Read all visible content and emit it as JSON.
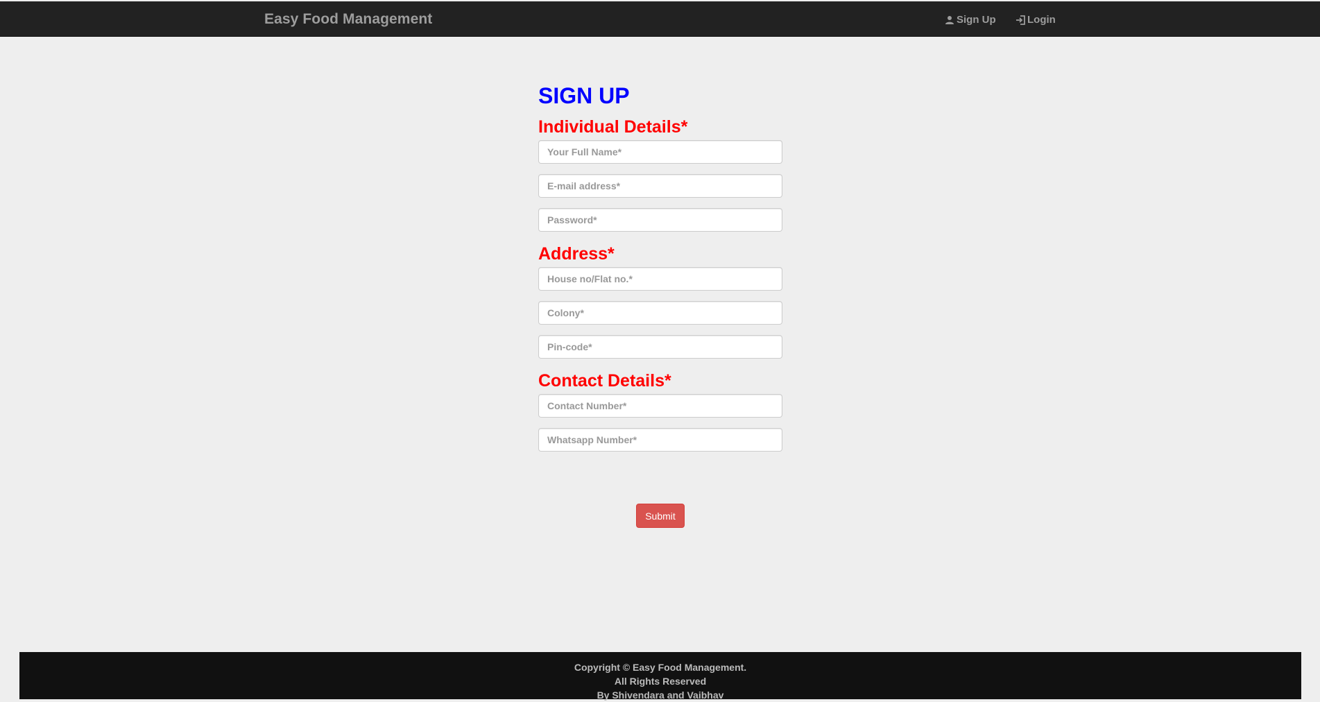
{
  "navbar": {
    "brand": "Easy Food Management",
    "signup_label": "Sign Up",
    "login_label": "Login"
  },
  "form": {
    "title": "SIGN UP",
    "sections": {
      "individual": {
        "title": "Individual Details*",
        "full_name_placeholder": "Your Full Name*",
        "email_placeholder": "E-mail address*",
        "password_placeholder": "Password*"
      },
      "address": {
        "title": "Address*",
        "house_placeholder": "House no/Flat no.*",
        "colony_placeholder": "Colony*",
        "pincode_placeholder": "Pin-code*"
      },
      "contact": {
        "title": "Contact Details*",
        "contact_placeholder": "Contact Number*",
        "whatsapp_placeholder": "Whatsapp Number*"
      }
    },
    "submit_label": "Submit"
  },
  "footer": {
    "line1": "Copyright © Easy Food Management.",
    "line2": "All Rights Reserved",
    "line3": "By Shivendara and Vaibhav"
  },
  "colors": {
    "navbar_bg": "#222222",
    "page_bg": "#eeeeee",
    "title": "#0000ff",
    "section_title": "#ff0000",
    "submit_bg": "#d9534f",
    "footer_bg": "#111111"
  },
  "icons": {
    "signup": "user-icon",
    "login": "login-icon"
  }
}
